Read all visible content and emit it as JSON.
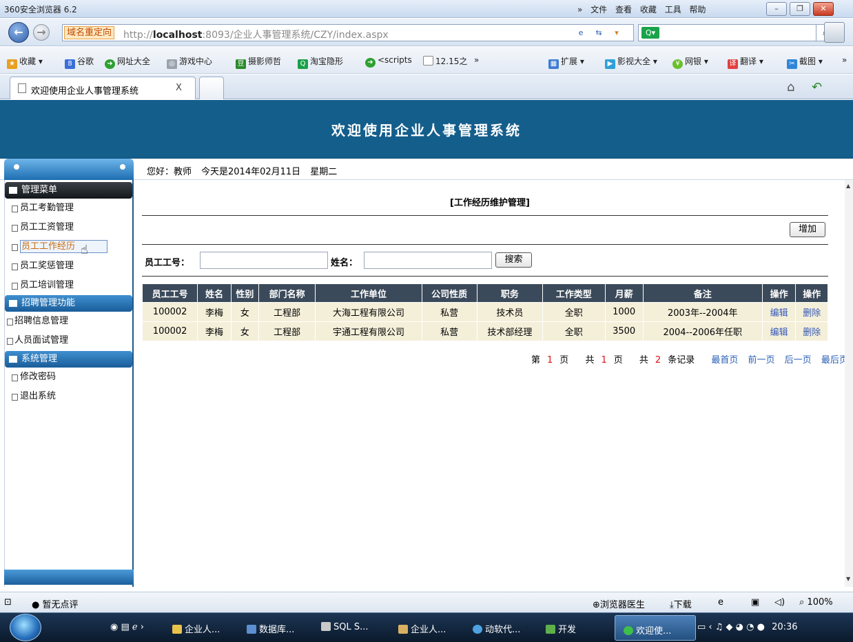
{
  "browser": {
    "title": "360安全浏览器 6.2",
    "menus": [
      "»",
      "文件",
      "查看",
      "收藏",
      "工具",
      "帮助"
    ],
    "redirect_badge": "域名重定向",
    "url_prefix": "http://",
    "url_host": "localhost",
    "url_rest": ":8093/企业人事管理系统/CZY/index.aspx",
    "favorites": [
      "收藏",
      "谷歌",
      "网址大全",
      "游戏中心",
      "摄影师哲",
      "淘宝隐形",
      "<scripts",
      "12.15之",
      "»"
    ],
    "favorites_right": [
      "扩展",
      "影视大全",
      "网银",
      "翻译",
      "截图",
      "»"
    ],
    "tab_title": "欢迎使用企业人事管理系统",
    "tab_close": "X"
  },
  "app": {
    "banner_title": "欢迎使用企业人事管理系统",
    "greeting": "您好：教师",
    "date_text": "今天是2014年02月11日",
    "weekday": "星期二"
  },
  "sidebar": {
    "group1": "管理菜单",
    "group1_items": [
      "员工考勤管理",
      "员工工资管理",
      "员工工作经历",
      "员工奖惩管理",
      "员工培训管理"
    ],
    "group2": "招聘管理功能",
    "group2_items": [
      "招聘信息管理",
      "人员面试管理"
    ],
    "group3": "系统管理",
    "group3_items": [
      "修改密码",
      "退出系统"
    ],
    "selected_item": "员工工作经历"
  },
  "main": {
    "heading": "[工作经历维护管理]",
    "add_button": "增加",
    "search_label_id": "员工工号：",
    "search_label_name": "姓名：",
    "search_id_value": "",
    "search_name_value": "",
    "search_button": "搜索",
    "columns": [
      "员工工号",
      "姓名",
      "性别",
      "部门名称",
      "工作单位",
      "公司性质",
      "职务",
      "工作类型",
      "月薪",
      "备注",
      "操作",
      "操作"
    ],
    "rows": [
      [
        "100002",
        "李梅",
        "女",
        "工程部",
        "大海工程有限公司",
        "私营",
        "技术员",
        "全职",
        "1000",
        "2003年--2004年",
        "编辑",
        "删除"
      ],
      [
        "100002",
        "李梅",
        "女",
        "工程部",
        "宇通工程有限公司",
        "私营",
        "技术部经理",
        "全职",
        "3500",
        "2004--2006年任职",
        "编辑",
        "删除"
      ]
    ],
    "pager": {
      "page_prefix": "第",
      "page_num": "1",
      "page_suffix": "页",
      "total_prefix": "共",
      "total_pages": "1",
      "total_suffix": "页",
      "rec_prefix": "共",
      "rec_count": "2",
      "rec_suffix": "条记录",
      "first": "最首页",
      "prev": "前一页",
      "next": "后一页",
      "last": "最后页"
    }
  },
  "statusbar": {
    "rating": "暂无点评",
    "doctor": "浏览器医生",
    "download": "下载",
    "zoom": "100%"
  },
  "taskbar": {
    "tasks": [
      "企业人...",
      "数据库...",
      "SQL S...",
      "企业人...",
      "动软代...",
      "开发"
    ],
    "active_task": "欢迎使...",
    "clock": "20:36"
  },
  "colors": {
    "banner": "#145e8c",
    "table_header": "#3b4a5a",
    "row_bg": "#f4efd9",
    "link": "#3558b8"
  }
}
